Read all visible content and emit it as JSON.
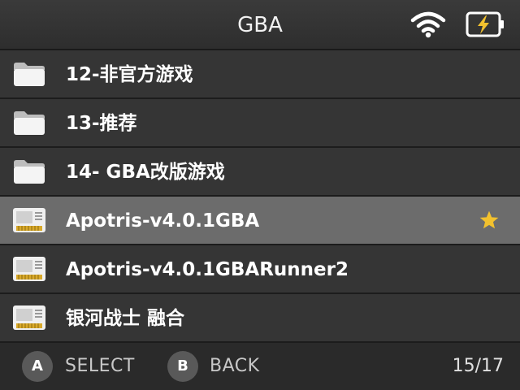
{
  "header": {
    "title": "GBA",
    "wifi_icon": "wifi-icon",
    "battery_icon": "battery-charging-icon",
    "accent": "#f2c12e"
  },
  "list": {
    "items": [
      {
        "label": "12-非官方游戏",
        "type": "folder",
        "icon": "folder-icon",
        "selected": false,
        "favorite": false
      },
      {
        "label": "13-推荐",
        "type": "folder",
        "icon": "folder-icon",
        "selected": false,
        "favorite": false
      },
      {
        "label": "14- GBA改版游戏",
        "type": "folder",
        "icon": "folder-icon",
        "selected": false,
        "favorite": false
      },
      {
        "label": "Apotris-v4.0.1GBA",
        "type": "rom",
        "icon": "cartridge-icon",
        "selected": true,
        "favorite": true
      },
      {
        "label": "Apotris-v4.0.1GBARunner2",
        "type": "rom",
        "icon": "cartridge-icon",
        "selected": false,
        "favorite": false
      },
      {
        "label": "银河战士 融合",
        "type": "rom",
        "icon": "cartridge-icon",
        "selected": false,
        "favorite": false
      }
    ],
    "favorite_icon": "star-icon",
    "favorite_color": "#f2c12e"
  },
  "footer": {
    "a_button": "A",
    "a_label": "SELECT",
    "b_button": "B",
    "b_label": "BACK",
    "page_counter": "15/17"
  }
}
